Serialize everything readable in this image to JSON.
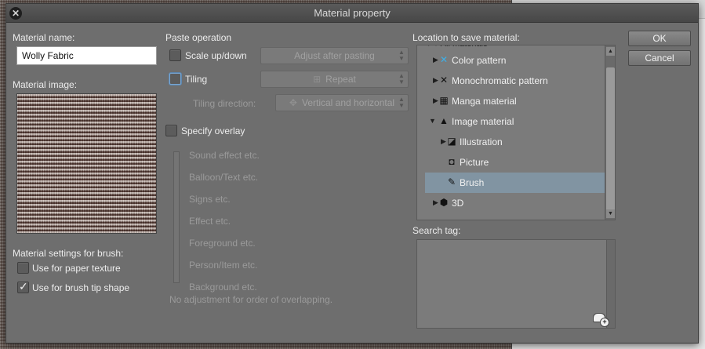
{
  "window": {
    "title": "Material property"
  },
  "material_name": {
    "label": "Material name:",
    "value": "Wolly Fabric"
  },
  "material_image": {
    "label": "Material image:"
  },
  "brush_settings": {
    "label": "Material settings for brush:",
    "paper_texture": {
      "label": "Use for paper texture",
      "checked": false
    },
    "brush_tip": {
      "label": "Use for brush tip shape",
      "checked": true
    }
  },
  "paste_operation": {
    "label": "Paste operation",
    "scale": {
      "label": "Scale up/down",
      "checked": false,
      "select_value": "Adjust after pasting"
    },
    "tiling": {
      "label": "Tiling",
      "checked": false,
      "select_value": "Repeat"
    },
    "tiling_direction": {
      "label": "Tiling direction:",
      "select_value": "Vertical and horizontal"
    }
  },
  "overlay": {
    "label": "Specify overlay",
    "checked": false,
    "levels": [
      "Sound effect etc.",
      "Balloon/Text etc.",
      "Signs etc.",
      "Effect etc.",
      "Foreground etc.",
      "Person/Item etc.",
      "Background etc."
    ],
    "note": "No adjustment for order of overlapping."
  },
  "location": {
    "label": "Location to save material:",
    "tree": [
      {
        "label": "Color pattern",
        "icon": "color-pattern-icon",
        "expanded": false
      },
      {
        "label": "Monochromatic pattern",
        "icon": "monochromatic-pattern-icon",
        "expanded": false
      },
      {
        "label": "Manga material",
        "icon": "manga-material-icon",
        "expanded": false
      },
      {
        "label": "Image material",
        "icon": "image-material-icon",
        "expanded": true
      },
      {
        "label": "Illustration",
        "icon": "illustration-icon",
        "expanded": false
      },
      {
        "label": "Picture",
        "icon": "camera-icon"
      },
      {
        "label": "Brush",
        "icon": "brush-icon",
        "selected": true
      },
      {
        "label": "3D",
        "icon": "cube-icon",
        "expanded": false
      }
    ]
  },
  "search_tag": {
    "label": "Search tag:"
  },
  "buttons": {
    "ok": "OK",
    "cancel": "Cancel"
  },
  "colors": {
    "dialog_bg": "#6e6e6e",
    "selection": "#8194a2",
    "focus": "#79a6d2"
  }
}
